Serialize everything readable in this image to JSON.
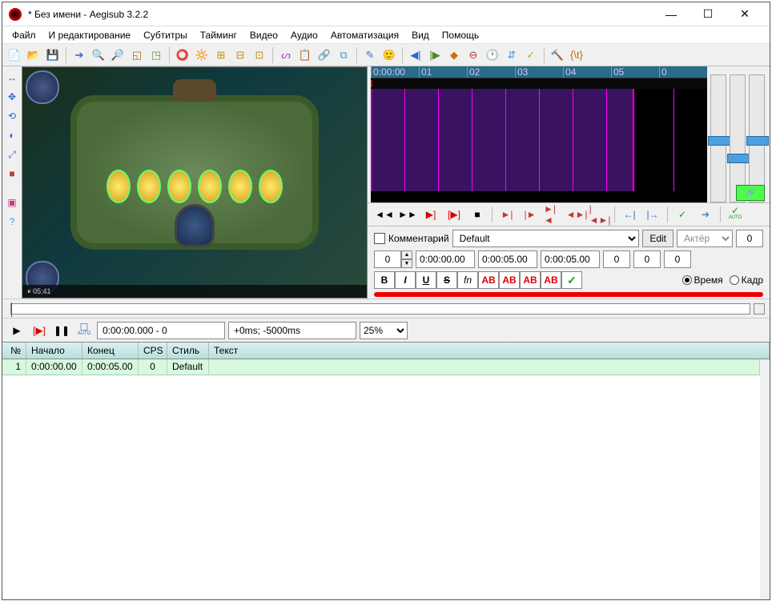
{
  "title": "* Без имени - Aegisub 3.2.2",
  "menu": [
    "Файл",
    "И редактирование",
    "Субтитры",
    "Тайминг",
    "Видео",
    "Аудио",
    "Автоматизация",
    "Вид",
    "Помощь"
  ],
  "waveform": {
    "ticks": [
      "0:00:00",
      "01",
      "02",
      "03",
      "04",
      "05",
      "0"
    ]
  },
  "audio_controls": {
    "play": "◄◄",
    "fwd": "►►",
    "sel_play": "▶]",
    "line_play": "[▶]",
    "stop": "■",
    "g1": "►|",
    "g2": "|►",
    "g3": "►|◄",
    "g4": "◄►|",
    "g5": "|◄►|",
    "lead_in": "←|",
    "lead_out": "|→",
    "commit": "✓",
    "next": "➔",
    "auto_commit": "✓",
    "auto_label": "AUTO"
  },
  "edit": {
    "comment_label": "Комментарий",
    "style_combo": "Default",
    "edit_btn": "Edit",
    "actor_placeholder": "Актёр",
    "effect_val": "0",
    "layer": "0",
    "start": "0:00:00.00",
    "end": "0:00:05.00",
    "dur": "0:00:05.00",
    "ml": "0",
    "mr": "0",
    "mv": "0",
    "bold": "B",
    "italic": "I",
    "underline": "U",
    "strike": "S",
    "fn": "fn",
    "c1": "AB",
    "c2": "AB",
    "c3": "AB",
    "c4": "AB",
    "accept": "✓",
    "time_radio": "Время",
    "frame_radio": "Кадр"
  },
  "video_ctrl": {
    "play": "▶",
    "play_line": "[▶]",
    "pause": "❚❚",
    "auto": "☐",
    "auto_label": "AUTO",
    "position": "0:00:00.000 - 0",
    "offset": "+0ms; -5000ms",
    "zoom": "25%"
  },
  "grid": {
    "headers": {
      "n": "№",
      "start": "Начало",
      "end": "Конец",
      "cps": "CPS",
      "style": "Стиль",
      "text": "Текст"
    },
    "rows": [
      {
        "n": "1",
        "start": "0:00:00.00",
        "end": "0:00:05.00",
        "cps": "0",
        "style": "Default",
        "text": ""
      }
    ]
  },
  "video_footer": "⏸  05:41"
}
